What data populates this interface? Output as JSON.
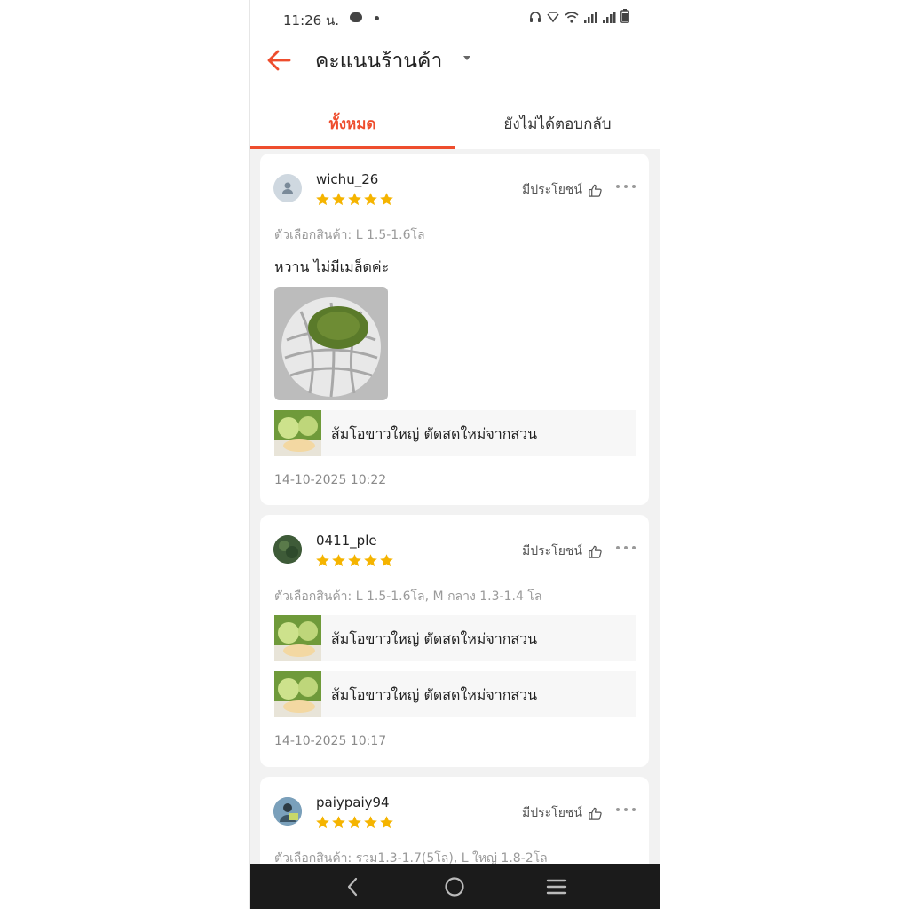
{
  "status_bar": {
    "time": "11:26 น."
  },
  "header": {
    "title": "คะแนนร้านค้า"
  },
  "tabs": [
    {
      "label": "ทั้งหมด"
    },
    {
      "label": "ยังไม่ได้ตอบกลับ"
    }
  ],
  "reviews": [
    {
      "username": "wichu_26",
      "rating": 5,
      "helpful_label": "มีประโยชน์",
      "variant": "ตัวเลือกสินค้า: L 1.5-1.6โล",
      "comment": "หวาน ไม่มีเมล็ดค่ะ",
      "products": [
        "ส้มโอขาวใหญ่ ตัดสดใหม่จากสวน"
      ],
      "date": "14-10-2025 10:22"
    },
    {
      "username": "0411_ple",
      "rating": 5,
      "helpful_label": "มีประโยชน์",
      "variant": "ตัวเลือกสินค้า: L 1.5-1.6โล, M กลาง 1.3-1.4 โล",
      "products": [
        "ส้มโอขาวใหญ่ ตัดสดใหม่จากสวน",
        "ส้มโอขาวใหญ่ ตัดสดใหม่จากสวน"
      ],
      "date": "14-10-2025 10:17"
    },
    {
      "username": "paiypaiy94",
      "rating": 5,
      "helpful_label": "มีประโยชน์",
      "variant": "ตัวเลือกสินค้า: รวม1.3-1.7(5โล), L ใหญ่ 1.8-2โล"
    }
  ],
  "colors": {
    "accent": "#ee4d2d",
    "star": "#f5b400",
    "navbar": "#1b1b1b"
  },
  "icons": [
    "back-arrow-icon",
    "dropdown-caret-icon",
    "thumbs-up-icon",
    "more-dots-icon",
    "star-icon",
    "nav-back-icon",
    "nav-home-icon",
    "nav-recents-icon"
  ]
}
